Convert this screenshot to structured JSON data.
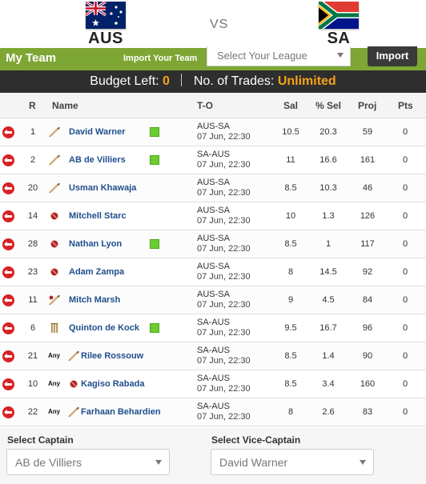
{
  "match": {
    "home": {
      "code": "AUS"
    },
    "vs": "VS",
    "away": {
      "code": "SA"
    }
  },
  "team_bar": {
    "title": "My Team",
    "import_label": "Import Your Team",
    "league_placeholder": "Select Your League",
    "import_button": "Import"
  },
  "budget": {
    "budget_label": "Budget Left:",
    "budget_value": "0",
    "trades_label": "No. of Trades:",
    "trades_value": "Unlimited"
  },
  "table": {
    "headers": {
      "rank": "R",
      "name": "Name",
      "to": "T-O",
      "sal": "Sal",
      "sel": "% Sel",
      "proj": "Proj",
      "pts": "Pts"
    },
    "rows": [
      {
        "rank": "1",
        "any": "",
        "role": "bat",
        "name": "David Warner",
        "status": true,
        "to": "AUS-SA",
        "date": "07 Jun, 22:30",
        "sal": "10.5",
        "sel": "20.3",
        "proj": "59",
        "pts": "0"
      },
      {
        "rank": "2",
        "any": "",
        "role": "bat",
        "name": "AB de Villiers",
        "status": true,
        "to": "SA-AUS",
        "date": "07 Jun, 22:30",
        "sal": "11",
        "sel": "16.6",
        "proj": "161",
        "pts": "0"
      },
      {
        "rank": "20",
        "any": "",
        "role": "bat",
        "name": "Usman Khawaja",
        "status": false,
        "to": "AUS-SA",
        "date": "07 Jun, 22:30",
        "sal": "8.5",
        "sel": "10.3",
        "proj": "46",
        "pts": "0"
      },
      {
        "rank": "14",
        "any": "",
        "role": "bowl",
        "name": "Mitchell Starc",
        "status": false,
        "to": "AUS-SA",
        "date": "07 Jun, 22:30",
        "sal": "10",
        "sel": "1.3",
        "proj": "126",
        "pts": "0"
      },
      {
        "rank": "28",
        "any": "",
        "role": "bowl",
        "name": "Nathan Lyon",
        "status": true,
        "to": "AUS-SA",
        "date": "07 Jun, 22:30",
        "sal": "8.5",
        "sel": "1",
        "proj": "117",
        "pts": "0"
      },
      {
        "rank": "23",
        "any": "",
        "role": "bowl",
        "name": "Adam Zampa",
        "status": false,
        "to": "AUS-SA",
        "date": "07 Jun, 22:30",
        "sal": "8",
        "sel": "14.5",
        "proj": "92",
        "pts": "0"
      },
      {
        "rank": "11",
        "any": "",
        "role": "ar",
        "name": "Mitch Marsh",
        "status": false,
        "to": "AUS-SA",
        "date": "07 Jun, 22:30",
        "sal": "9",
        "sel": "4.5",
        "proj": "84",
        "pts": "0"
      },
      {
        "rank": "6",
        "any": "",
        "role": "wk",
        "name": "Quinton de Kock",
        "status": true,
        "to": "SA-AUS",
        "date": "07 Jun, 22:30",
        "sal": "9.5",
        "sel": "16.7",
        "proj": "96",
        "pts": "0"
      },
      {
        "rank": "21",
        "any": "Any",
        "role": "bat",
        "name": "Rilee Rossouw",
        "status": false,
        "to": "SA-AUS",
        "date": "07 Jun, 22:30",
        "sal": "8.5",
        "sel": "1.4",
        "proj": "90",
        "pts": "0"
      },
      {
        "rank": "10",
        "any": "Any",
        "role": "bowl",
        "name": "Kagiso Rabada",
        "status": false,
        "to": "SA-AUS",
        "date": "07 Jun, 22:30",
        "sal": "8.5",
        "sel": "3.4",
        "proj": "160",
        "pts": "0"
      },
      {
        "rank": "22",
        "any": "Any",
        "role": "bat",
        "name": "Farhaan Behardien",
        "status": false,
        "to": "SA-AUS",
        "date": "07 Jun, 22:30",
        "sal": "8",
        "sel": "2.6",
        "proj": "83",
        "pts": "0"
      }
    ]
  },
  "captain": {
    "captain_label": "Select Captain",
    "captain_value": "AB de Villiers",
    "vice_label": "Select Vice-Captain",
    "vice_value": "David Warner"
  },
  "colors": {
    "green_bar": "#7ea634",
    "budget_bar": "#2e2e2e",
    "highlight": "#f7a21a",
    "remove": "#d82222",
    "name_link": "#1f4e8c",
    "status_green": "#6ccc32"
  }
}
